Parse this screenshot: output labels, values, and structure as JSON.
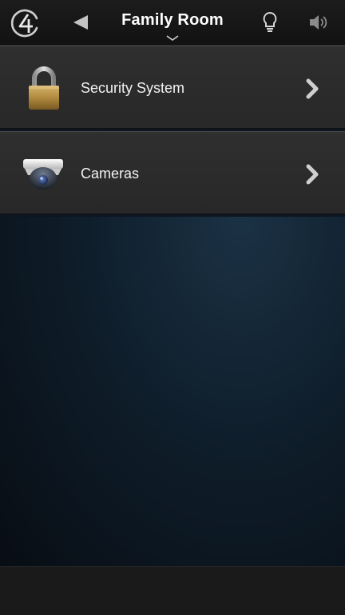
{
  "header": {
    "room_title": "Family Room",
    "icons": {
      "logo": "control4-logo-icon",
      "back": "back-arrow-icon",
      "room_menu": "chevron-down-icon",
      "lights": "lightbulb-icon",
      "volume": "speaker-volume-icon"
    }
  },
  "menu": {
    "items": [
      {
        "label": "Security System",
        "icon": "padlock-icon",
        "arrow": "chevron-right-icon"
      },
      {
        "label": "Cameras",
        "icon": "security-camera-icon",
        "arrow": "chevron-right-icon"
      }
    ]
  },
  "colors": {
    "topbar_bg": "#161616",
    "item_bg": "#2c2c2c",
    "content_bg": "#0f1e2b",
    "text": "#ffffff"
  }
}
